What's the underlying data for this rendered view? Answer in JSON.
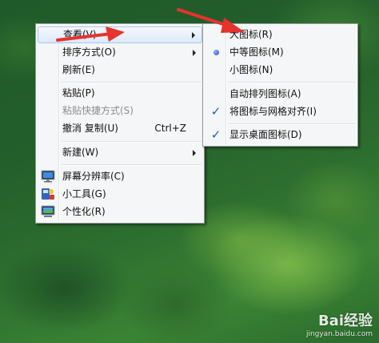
{
  "context_menu": {
    "items": [
      {
        "label": "查看(V)"
      },
      {
        "label": "排序方式(O)"
      },
      {
        "label": "刷新(E)"
      },
      {
        "label": "粘贴(P)"
      },
      {
        "label": "粘贴快捷方式(S)"
      },
      {
        "label": "撤消 复制(U)",
        "shortcut": "Ctrl+Z"
      },
      {
        "label": "新建(W)"
      },
      {
        "label": "屏幕分辨率(C)",
        "icon": "screen-resolution-icon"
      },
      {
        "label": "小工具(G)",
        "icon": "gadgets-icon"
      },
      {
        "label": "个性化(R)",
        "icon": "personalize-icon"
      }
    ]
  },
  "view_submenu": {
    "items": [
      {
        "label": "大图标(R)"
      },
      {
        "label": "中等图标(M)",
        "selected": true
      },
      {
        "label": "小图标(N)"
      },
      {
        "label": "自动排列图标(A)"
      },
      {
        "label": "将图标与网格对齐(I)",
        "checked": true
      },
      {
        "label": "显示桌面图标(D)",
        "checked": true
      }
    ]
  },
  "watermark": {
    "logo": "Bai经验",
    "url": "jingyan.baidu.com"
  },
  "colors": {
    "annotation_arrow": "#e8322c",
    "check": "#1c5dc8"
  }
}
